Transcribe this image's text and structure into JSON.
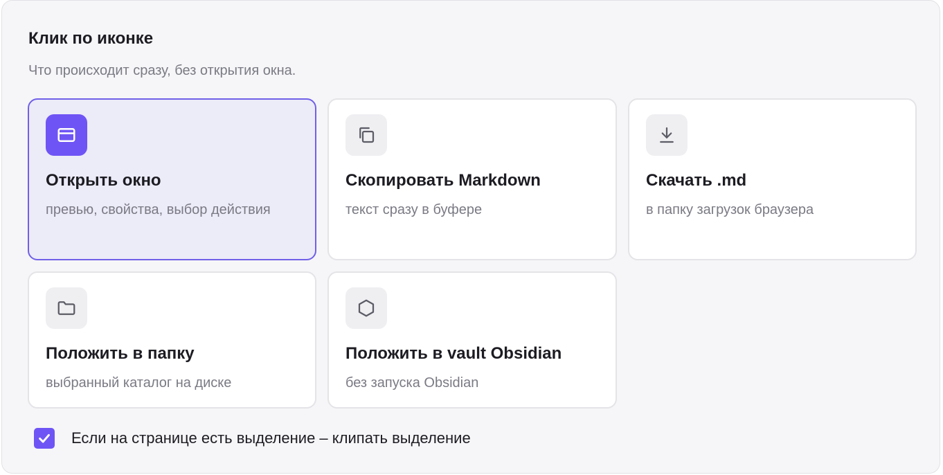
{
  "section": {
    "title": "Клик по иконке",
    "subtitle": "Что происходит сразу, без открытия окна."
  },
  "options": [
    {
      "title": "Открыть окно",
      "description": "превью, свойства, выбор действия",
      "icon": "window-icon",
      "selected": true
    },
    {
      "title": "Скопировать Markdown",
      "description": "текст сразу в буфере",
      "icon": "copy-icon",
      "selected": false
    },
    {
      "title": "Скачать .md",
      "description": "в папку загрузок браузера",
      "icon": "download-icon",
      "selected": false
    },
    {
      "title": "Положить в папку",
      "description": "выбранный каталог на диске",
      "icon": "folder-icon",
      "selected": false
    },
    {
      "title": "Положить в vault Obsidian",
      "description": "без запуска Obsidian",
      "icon": "hexagon-icon",
      "selected": false
    }
  ],
  "selection_option": {
    "label": "Если на странице есть выделение – клипать выделение",
    "checked": true
  },
  "colors": {
    "accent": "#6f54f5",
    "selected_bg": "#ecebf8",
    "selected_border": "#7060e8",
    "panel_bg": "#f6f6f8"
  }
}
